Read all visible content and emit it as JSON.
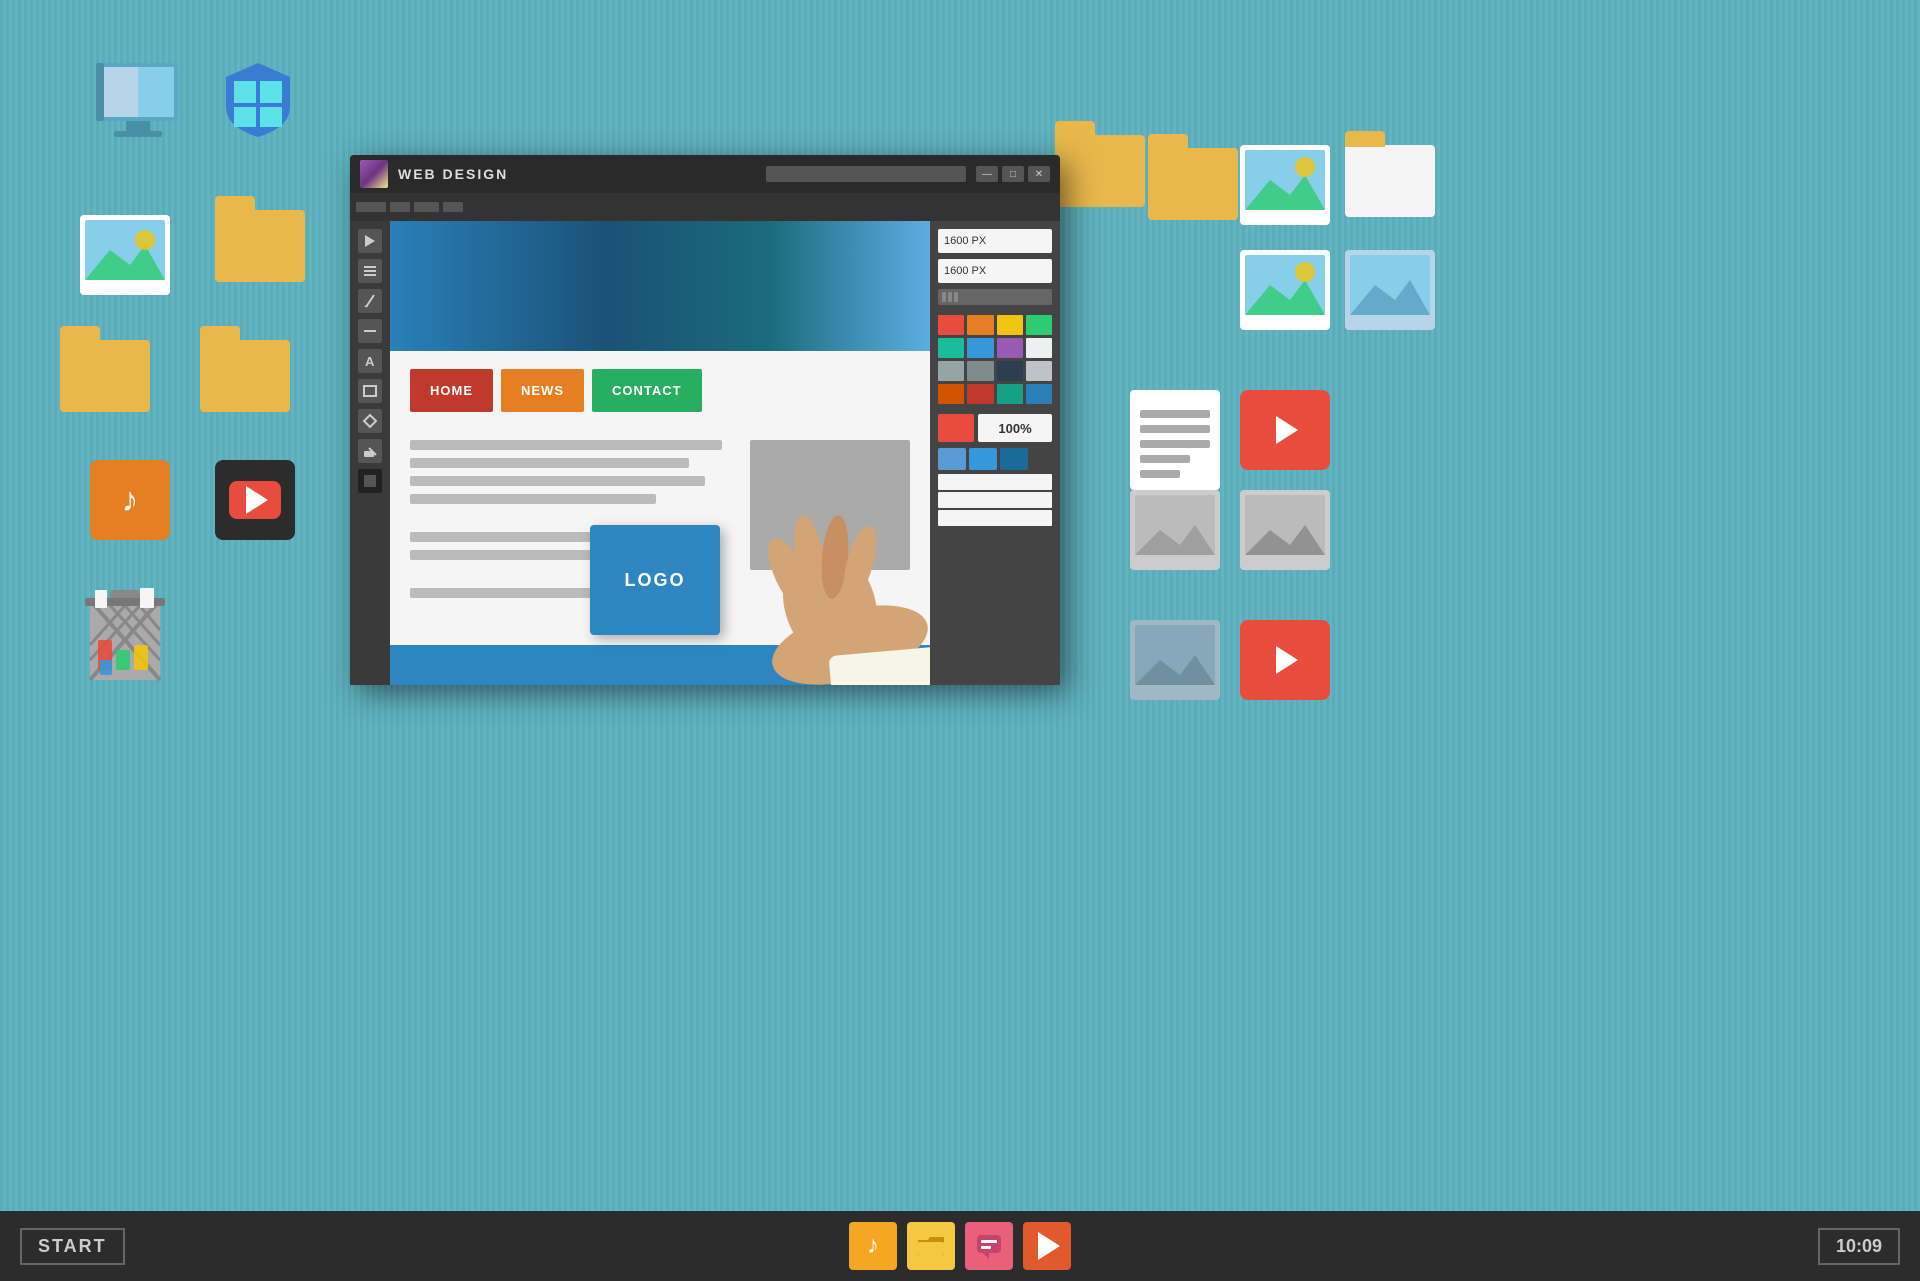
{
  "background": {
    "color": "#5aacb8"
  },
  "window": {
    "title": "WEB DESIGN",
    "icon_label": "web-design-icon",
    "controls": {
      "minimize": "—",
      "maximize": "□",
      "close": "✕"
    },
    "width_field": "1600 PX",
    "height_field": "1600 PX",
    "zoom": "100%"
  },
  "site": {
    "nav": {
      "home": "HOME",
      "news": "NEWS",
      "contact": "CONTACT"
    },
    "logo": "LOGO"
  },
  "taskbar": {
    "start": "START",
    "time": "10:09",
    "icons": {
      "music": "♪",
      "folder": "📁",
      "chat": "💬",
      "play": "▶"
    }
  },
  "colors": {
    "bg_teal": "#5aacb8",
    "window_dark": "#2a2a2a",
    "nav_home": "#c0392b",
    "nav_news": "#e67e22",
    "nav_contact": "#27ae60",
    "logo_blue": "#2e86c1",
    "taskbar": "#2c2c2c"
  },
  "color_swatches": [
    "#e74c3c",
    "#e67e22",
    "#f1c40f",
    "#2ecc71",
    "#1abc9c",
    "#3498db",
    "#9b59b6",
    "#ecf0f1",
    "#95a5a6",
    "#7f8c8d",
    "#2c3e50",
    "#bdc3c7",
    "#d35400",
    "#c0392b",
    "#16a085",
    "#2980b9"
  ],
  "desktop_items": {
    "folders": [
      "folder-1",
      "folder-2",
      "folder-3",
      "folder-4",
      "folder-5"
    ],
    "images": [
      "image-1",
      "image-2",
      "image-3",
      "image-4"
    ],
    "apps": [
      "music",
      "video",
      "trash"
    ]
  }
}
